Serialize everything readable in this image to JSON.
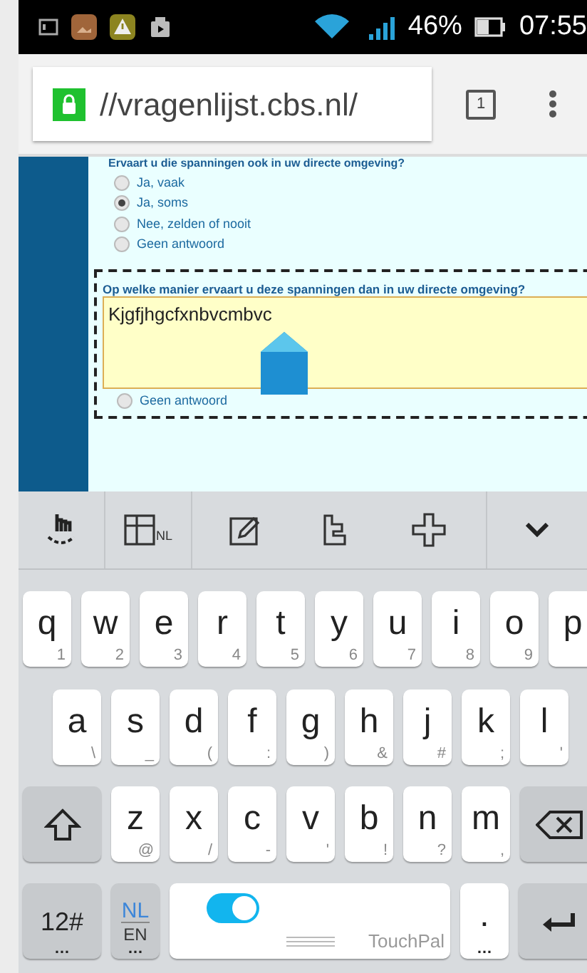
{
  "status_bar": {
    "battery": "46%",
    "time": "07:55"
  },
  "browser": {
    "url": "//vragenlijst.cbs.nl/",
    "tab_count": "1"
  },
  "survey": {
    "question_1": {
      "text": "Ervaart u die spanningen ook in uw directe omgeving?",
      "options": [
        {
          "label": "Ja, vaak",
          "selected": false
        },
        {
          "label": "Ja, soms",
          "selected": true
        },
        {
          "label": "Nee, zelden of nooit",
          "selected": false
        },
        {
          "label": "Geen antwoord",
          "selected": false
        }
      ]
    },
    "question_2": {
      "text": "Op welke manier ervaart u deze spanningen dan in uw directe omgeving?",
      "answer": "Kjgfjhgcfxnbvcmbvc",
      "options": [
        {
          "label": "Geen antwoord",
          "selected": false
        }
      ]
    }
  },
  "keyboard": {
    "layout_badge": "NL",
    "rows": [
      {
        "keys": [
          {
            "kind": "letter",
            "label": "q",
            "hint": "1"
          },
          {
            "kind": "letter",
            "label": "w",
            "hint": "2"
          },
          {
            "kind": "letter",
            "label": "e",
            "hint": "3"
          },
          {
            "kind": "letter",
            "label": "r",
            "hint": "4"
          },
          {
            "kind": "letter",
            "label": "t",
            "hint": "5"
          },
          {
            "kind": "letter",
            "label": "y",
            "hint": "6"
          },
          {
            "kind": "letter",
            "label": "u",
            "hint": "7"
          },
          {
            "kind": "letter",
            "label": "i",
            "hint": "8"
          },
          {
            "kind": "letter",
            "label": "o",
            "hint": "9"
          },
          {
            "kind": "letter",
            "label": "p"
          }
        ]
      },
      {
        "keys": [
          {
            "kind": "letter",
            "label": "a",
            "hint": "\\"
          },
          {
            "kind": "letter",
            "label": "s",
            "hint": "_"
          },
          {
            "kind": "letter",
            "label": "d",
            "hint": "("
          },
          {
            "kind": "letter",
            "label": "f",
            "hint": ":"
          },
          {
            "kind": "letter",
            "label": "g",
            "hint": ")"
          },
          {
            "kind": "letter",
            "label": "h",
            "hint": "&"
          },
          {
            "kind": "letter",
            "label": "j",
            "hint": "#"
          },
          {
            "kind": "letter",
            "label": "k",
            "hint": ";"
          },
          {
            "kind": "letter",
            "label": "l",
            "hint": "'"
          }
        ]
      },
      {
        "keys": [
          {
            "kind": "shift"
          },
          {
            "kind": "letter",
            "label": "z",
            "hint": "@"
          },
          {
            "kind": "letter",
            "label": "x",
            "hint": "/"
          },
          {
            "kind": "letter",
            "label": "c",
            "hint": "-"
          },
          {
            "kind": "letter",
            "label": "v",
            "hint": "'"
          },
          {
            "kind": "letter",
            "label": "b",
            "hint": "!"
          },
          {
            "kind": "letter",
            "label": "n",
            "hint": "?"
          },
          {
            "kind": "letter",
            "label": "m",
            "hint": ","
          },
          {
            "kind": "backspace"
          }
        ]
      },
      {
        "keys": [
          {
            "kind": "symbols",
            "label": "12#",
            "hint": "…"
          },
          {
            "kind": "language",
            "label": "NL",
            "secondary": "EN",
            "hint": "…"
          },
          {
            "kind": "space",
            "label": "TouchPal",
            "on": true
          },
          {
            "kind": "period",
            "label": ".",
            "hint": "…"
          },
          {
            "kind": "enter"
          }
        ]
      }
    ]
  }
}
